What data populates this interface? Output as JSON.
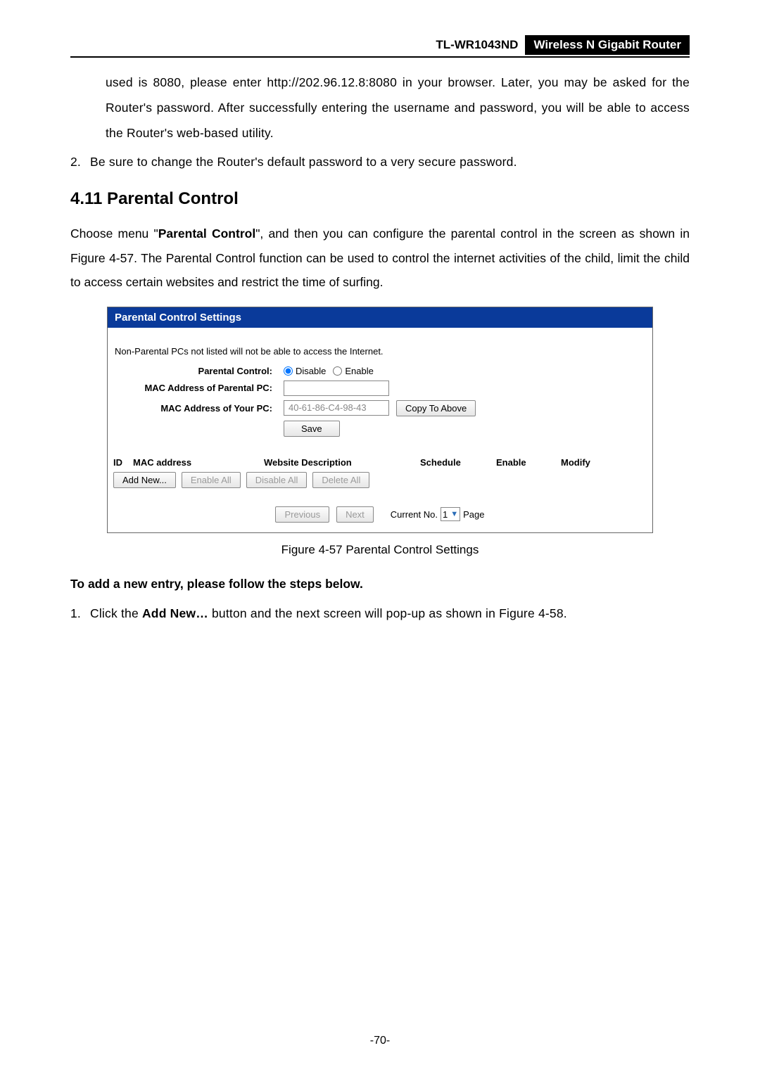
{
  "header": {
    "model": "TL-WR1043ND",
    "product": "Wireless N Gigabit Router"
  },
  "continued_para": "used is 8080, please enter http://202.96.12.8:8080 in your browser. Later, you may be asked for the Router's password. After successfully entering the username and password, you will be able to access the Router's web-based utility.",
  "note2_num": "2.",
  "note2_text": "Be sure to change the Router's default password to a very secure password.",
  "section_heading": "4.11  Parental Control",
  "intro_para_pre": "Choose menu \"",
  "intro_para_bold": "Parental Control",
  "intro_para_post": "\", and then you can configure the parental control in the screen as shown in Figure 4-57. The Parental Control function can be used to control the internet activities of the child, limit the child to access certain websites and restrict the time of surfing.",
  "screenshot": {
    "title": "Parental Control Settings",
    "note": "Non-Parental PCs not listed will not be able to access the Internet.",
    "labels": {
      "parental_control": "Parental Control:",
      "mac_parental": "MAC Address of Parental PC:",
      "mac_your": "MAC Address of Your PC:"
    },
    "radios": {
      "disable": "Disable",
      "enable": "Enable"
    },
    "mac_value": "40-61-86-C4-98-43",
    "buttons": {
      "copy": "Copy To Above",
      "save": "Save",
      "add_new": "Add New...",
      "enable_all": "Enable All",
      "disable_all": "Disable All",
      "delete_all": "Delete All",
      "previous": "Previous",
      "next": "Next"
    },
    "table_head": {
      "id": "ID",
      "mac": "MAC address",
      "desc": "Website Description",
      "schedule": "Schedule",
      "enable": "Enable",
      "modify": "Modify"
    },
    "pager": {
      "current_no": "Current No.",
      "value": "1",
      "page": "Page"
    }
  },
  "figure_caption": "Figure 4-57    Parental Control Settings",
  "subhead": "To add a new entry, please follow the steps below.",
  "step1_num": "1.",
  "step1_a": "Click the ",
  "step1_b": "Add New…",
  "step1_c": " button and the next screen will pop-up as shown in Figure 4-58.",
  "page_number": "-70-"
}
